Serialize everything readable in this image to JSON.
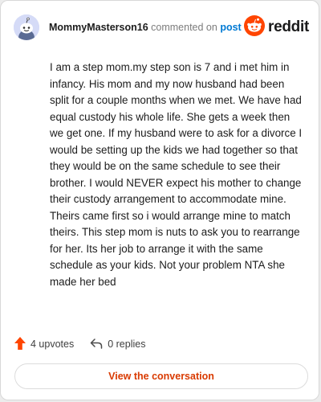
{
  "comment": {
    "author": "MommyMasterson16",
    "action_text": "commented on",
    "target_link": "post",
    "brand": "reddit",
    "body": "I am a step mom.my step son is 7 and i met him in infancy. His mom and my now husband had been split for a couple months when we met. We have had equal custody his whole life. She gets a week then we get one. If my husband were to ask for a divorce I would be setting up the kids we had together so that they would be on the same schedule to see their brother. I would NEVER expect his mother to change their custody arrangement to accommodate mine. Theirs came first so i would arrange mine to match theirs. This step mom is nuts to ask you to rearrange for her. Its her job to arrange it with the same schedule as your kids. Not your problem NTA she made her bed"
  },
  "footer": {
    "upvotes_label": "4 upvotes",
    "replies_label": "0 replies"
  },
  "cta": {
    "label": "View the conversation"
  },
  "icons": {
    "avatar": "snoo-avatar-icon",
    "brand": "reddit-logo-icon",
    "upvote": "upvote-arrow-icon",
    "reply": "reply-arrow-icon"
  },
  "colors": {
    "brand_orange": "#ff4500",
    "link_blue": "#0079d3",
    "cta_text": "#d93a00",
    "avatar_bg": "#d5dbf7"
  }
}
